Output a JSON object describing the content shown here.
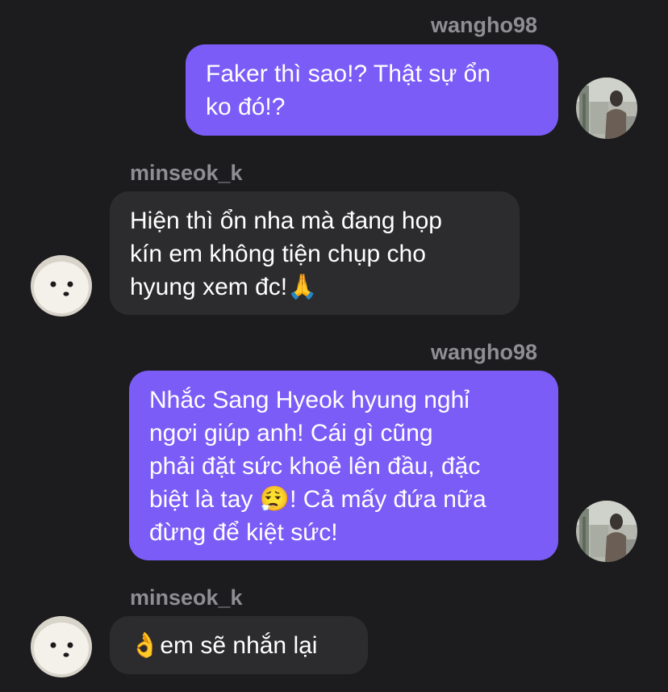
{
  "conversation": {
    "messages": [
      {
        "sender": "wangho98",
        "direction": "outgoing",
        "text": "Faker thì sao!? Thật sự ổn\nko đó!?"
      },
      {
        "sender": "minseok_k",
        "direction": "incoming",
        "text": "Hiện thì ổn nha mà đang họp\nkín em không tiện chụp cho\nhyung xem đc!🙏"
      },
      {
        "sender": "wangho98",
        "direction": "outgoing",
        "text": "Nhắc Sang Hyeok hyung nghỉ\nngơi giúp anh! Cái gì cũng\nphải đặt sức khoẻ lên đầu, đặc\nbiệt là tay 😮‍💨! Cả mấy đứa nữa\nđừng để kiệt sức!"
      },
      {
        "sender": "minseok_k",
        "direction": "incoming",
        "text": "👌em sẽ nhắn lại"
      }
    ]
  },
  "colors": {
    "background": "#1c1c1e",
    "outgoing_bubble": "#7b5cf7",
    "incoming_bubble": "#2c2c2e",
    "username": "#8e8e93",
    "message_text": "#ffffff"
  },
  "avatars": {
    "wangho98": "person-photo-avatar",
    "minseok_k": "white-dog-photo-avatar"
  }
}
